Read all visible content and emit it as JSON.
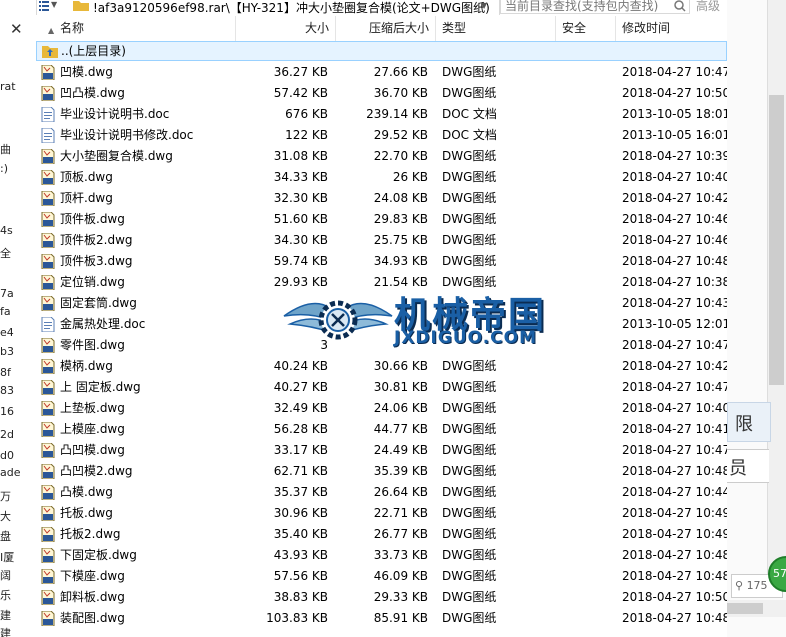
{
  "window": {
    "path": "!af3a9120596ef98.rar\\【HY-321】冲大小垫圈复合模(论文+DWG图纸)",
    "search_placeholder": "当前目录查找(支持包内查找)",
    "advanced_label": "高级"
  },
  "columns": {
    "name": "名称",
    "size": "大小",
    "compressed": "压缩后大小",
    "type": "类型",
    "security": "安全",
    "modified": "修改时间"
  },
  "parent_dir": "..(上层目录)",
  "files": [
    {
      "name": "凹模.dwg",
      "size": "36.27 KB",
      "compressed": "27.66 KB",
      "type": "DWG图纸",
      "modified": "2018-04-27 10:47:",
      "icon": "dwg"
    },
    {
      "name": "凹凸模.dwg",
      "size": "57.42 KB",
      "compressed": "36.70 KB",
      "type": "DWG图纸",
      "modified": "2018-04-27 10:50:",
      "icon": "dwg"
    },
    {
      "name": "毕业设计说明书.doc",
      "size": "676 KB",
      "compressed": "239.14 KB",
      "type": "DOC 文档",
      "modified": "2013-10-05 18:01:",
      "icon": "doc"
    },
    {
      "name": "毕业设计说明书修改.doc",
      "size": "122 KB",
      "compressed": "29.52 KB",
      "type": "DOC 文档",
      "modified": "2013-10-05 16:01:",
      "icon": "doc"
    },
    {
      "name": "大小垫圈复合模.dwg",
      "size": "31.08 KB",
      "compressed": "22.70 KB",
      "type": "DWG图纸",
      "modified": "2018-04-27 10:39:",
      "icon": "dwg"
    },
    {
      "name": "顶板.dwg",
      "size": "34.33 KB",
      "compressed": "26 KB",
      "type": "DWG图纸",
      "modified": "2018-04-27 10:40:",
      "icon": "dwg"
    },
    {
      "name": "顶杆.dwg",
      "size": "32.30 KB",
      "compressed": "24.08 KB",
      "type": "DWG图纸",
      "modified": "2018-04-27 10:42:",
      "icon": "dwg"
    },
    {
      "name": "顶件板.dwg",
      "size": "51.60 KB",
      "compressed": "29.83 KB",
      "type": "DWG图纸",
      "modified": "2018-04-27 10:46:",
      "icon": "dwg"
    },
    {
      "name": "顶件板2.dwg",
      "size": "34.30 KB",
      "compressed": "25.75 KB",
      "type": "DWG图纸",
      "modified": "2018-04-27 10:46:",
      "icon": "dwg"
    },
    {
      "name": "顶件板3.dwg",
      "size": "59.74 KB",
      "compressed": "34.93 KB",
      "type": "DWG图纸",
      "modified": "2018-04-27 10:48:",
      "icon": "dwg"
    },
    {
      "name": "定位销.dwg",
      "size": "29.93 KB",
      "compressed": "21.54 KB",
      "type": "DWG图纸",
      "modified": "2018-04-27 10:38:",
      "icon": "dwg"
    },
    {
      "name": "固定套筒.dwg",
      "size": "",
      "compressed": "",
      "type": "",
      "modified": "2018-04-27 10:43:",
      "icon": "dwg"
    },
    {
      "name": "金属热处理.doc",
      "size": "",
      "compressed": "",
      "type": "",
      "modified": "2013-10-05 12:01:",
      "icon": "doc"
    },
    {
      "name": "零件图.dwg",
      "size": "3",
      "compressed": "",
      "type": "",
      "modified": "2018-04-27 10:47:",
      "icon": "dwg"
    },
    {
      "name": "模柄.dwg",
      "size": "40.24 KB",
      "compressed": "30.66 KB",
      "type": "DWG图纸",
      "modified": "2018-04-27 10:42:",
      "icon": "dwg"
    },
    {
      "name": "上 固定板.dwg",
      "size": "40.27 KB",
      "compressed": "30.81 KB",
      "type": "DWG图纸",
      "modified": "2018-04-27 10:47:",
      "icon": "dwg"
    },
    {
      "name": "上垫板.dwg",
      "size": "32.49 KB",
      "compressed": "24.06 KB",
      "type": "DWG图纸",
      "modified": "2018-04-27 10:40:",
      "icon": "dwg"
    },
    {
      "name": "上模座.dwg",
      "size": "56.28 KB",
      "compressed": "44.77 KB",
      "type": "DWG图纸",
      "modified": "2018-04-27 10:41:",
      "icon": "dwg"
    },
    {
      "name": "凸凹模.dwg",
      "size": "33.17 KB",
      "compressed": "24.49 KB",
      "type": "DWG图纸",
      "modified": "2018-04-27 10:47:",
      "icon": "dwg"
    },
    {
      "name": "凸凹模2.dwg",
      "size": "62.71 KB",
      "compressed": "35.39 KB",
      "type": "DWG图纸",
      "modified": "2018-04-27 10:48:",
      "icon": "dwg"
    },
    {
      "name": "凸模.dwg",
      "size": "35.37 KB",
      "compressed": "26.64 KB",
      "type": "DWG图纸",
      "modified": "2018-04-27 10:44:",
      "icon": "dwg"
    },
    {
      "name": "托板.dwg",
      "size": "30.96 KB",
      "compressed": "22.71 KB",
      "type": "DWG图纸",
      "modified": "2018-04-27 10:49:",
      "icon": "dwg"
    },
    {
      "name": "托板2.dwg",
      "size": "35.40 KB",
      "compressed": "26.77 KB",
      "type": "DWG图纸",
      "modified": "2018-04-27 10:49:",
      "icon": "dwg"
    },
    {
      "name": "下固定板.dwg",
      "size": "43.93 KB",
      "compressed": "33.73 KB",
      "type": "DWG图纸",
      "modified": "2018-04-27 10:48:",
      "icon": "dwg"
    },
    {
      "name": "下模座.dwg",
      "size": "57.56 KB",
      "compressed": "46.09 KB",
      "type": "DWG图纸",
      "modified": "2018-04-27 10:48:",
      "icon": "dwg"
    },
    {
      "name": "卸料板.dwg",
      "size": "38.83 KB",
      "compressed": "29.33 KB",
      "type": "DWG图纸",
      "modified": "2018-04-27 10:50:",
      "icon": "dwg"
    },
    {
      "name": "装配图.dwg",
      "size": "103.83 KB",
      "compressed": "85.91 KB",
      "type": "DWG图纸",
      "modified": "2018-04-27 10:48:",
      "icon": "dwg"
    }
  ],
  "watermark": {
    "cn": "机械帝国",
    "en": "JXDIGUO.COM"
  },
  "left_fragments": [
    "rat",
    "曲",
    ":)",
    "4s",
    "全",
    "7a",
    "fa",
    "e4",
    "b3",
    "8f",
    "83",
    "16",
    "2d",
    "d0",
    "ade",
    "万",
    "大",
    "盘",
    "I厦",
    "阔",
    "乐",
    "建",
    "建"
  ],
  "right_fragments": {
    "label1": "限",
    "label2": "员",
    "badge": "57",
    "search_text": "175"
  },
  "colors": {
    "selection_bg": "#e5f3ff",
    "selection_border": "#99d1ff",
    "watermark_blue": "#1a5fa5",
    "badge_green": "#3aa843"
  }
}
